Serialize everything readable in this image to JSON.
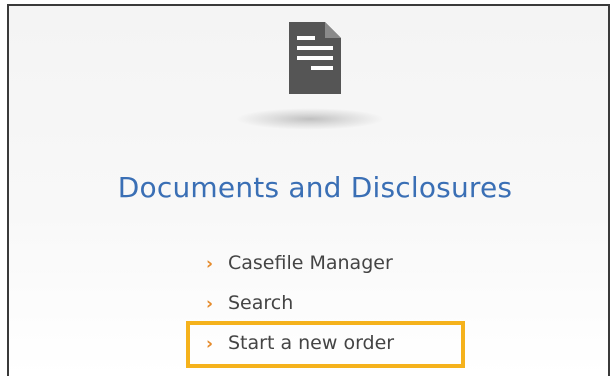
{
  "section": {
    "icon": "document-icon",
    "title": "Documents and Disclosures"
  },
  "links": [
    {
      "label": "Casefile Manager",
      "icon": "chevron-right-icon"
    },
    {
      "label": "Search",
      "icon": "chevron-right-icon"
    },
    {
      "label": "Start a new order",
      "icon": "chevron-right-icon",
      "highlighted": true
    }
  ],
  "colors": {
    "title": "#3a6fb5",
    "chevron": "#e58a2a",
    "highlight_border": "#f5b21c",
    "icon": "#555555"
  }
}
